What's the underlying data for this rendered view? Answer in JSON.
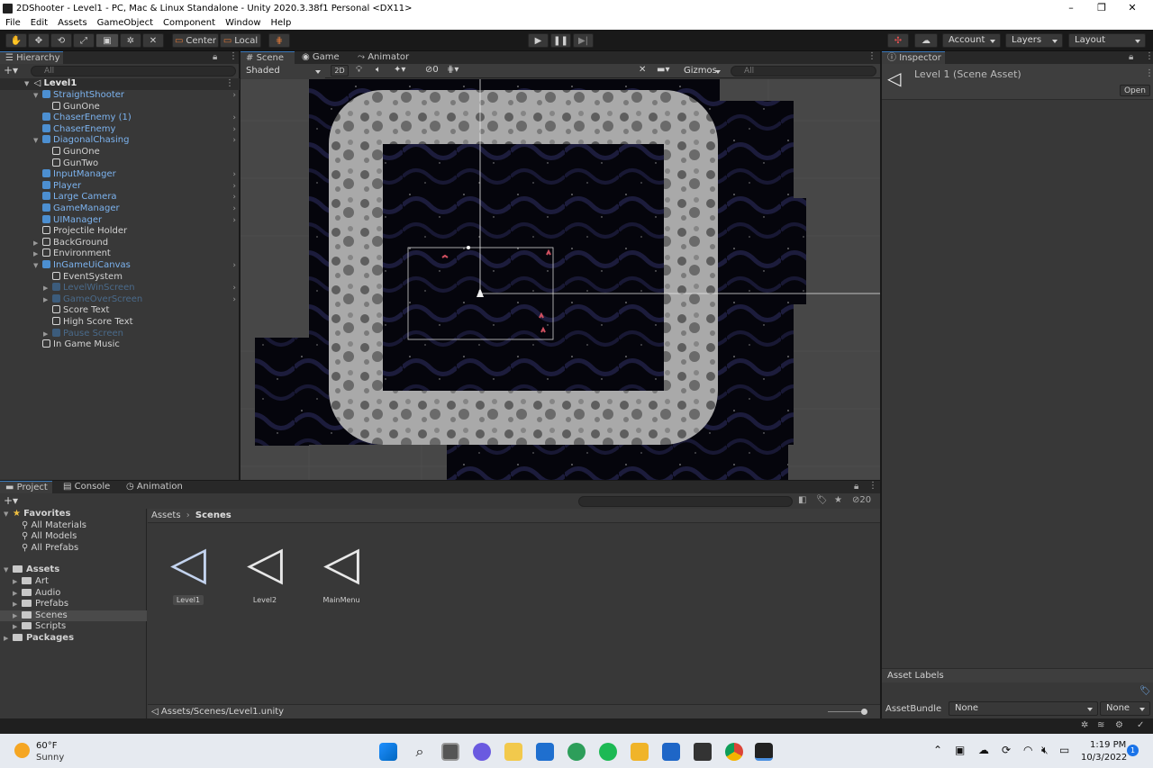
{
  "window": {
    "title": "2DShooter - Level1 - PC, Mac & Linux Standalone - Unity 2020.3.38f1 Personal <DX11>",
    "min": "–",
    "max": "❐",
    "close": "✕"
  },
  "menu": [
    "File",
    "Edit",
    "Assets",
    "GameObject",
    "Component",
    "Window",
    "Help"
  ],
  "toolbar": {
    "center": "Center",
    "local": "Local",
    "account": "Account",
    "layers": "Layers",
    "layout": "Layout"
  },
  "hierarchy": {
    "tab": "Hierarchy",
    "search_placeholder": "All",
    "scene_root": "Level1",
    "items": [
      {
        "label": "StraightShooter",
        "style": "blue",
        "indent": 1,
        "fold": "▼",
        "arrow": true
      },
      {
        "label": "GunOne",
        "style": "white",
        "indent": 2,
        "fold": "",
        "arrow": false
      },
      {
        "label": "ChaserEnemy (1)",
        "style": "blue",
        "indent": 1,
        "fold": "",
        "arrow": true
      },
      {
        "label": "ChaserEnemy",
        "style": "blue",
        "indent": 1,
        "fold": "",
        "arrow": true
      },
      {
        "label": "DiagonalChasing",
        "style": "blue",
        "indent": 1,
        "fold": "▼",
        "arrow": true
      },
      {
        "label": "GunOne",
        "style": "white",
        "indent": 2,
        "fold": "",
        "arrow": false
      },
      {
        "label": "GunTwo",
        "style": "white",
        "indent": 2,
        "fold": "",
        "arrow": false
      },
      {
        "label": "InputManager",
        "style": "blue",
        "indent": 1,
        "fold": "",
        "arrow": true
      },
      {
        "label": "Player",
        "style": "blue",
        "indent": 1,
        "fold": "",
        "arrow": true
      },
      {
        "label": "Large Camera",
        "style": "blue",
        "indent": 1,
        "fold": "",
        "arrow": true
      },
      {
        "label": "GameManager",
        "style": "blue",
        "indent": 1,
        "fold": "",
        "arrow": true
      },
      {
        "label": "UIManager",
        "style": "blue",
        "indent": 1,
        "fold": "",
        "arrow": true
      },
      {
        "label": "Projectile Holder",
        "style": "white",
        "indent": 1,
        "fold": "",
        "arrow": false
      },
      {
        "label": "BackGround",
        "style": "white",
        "indent": 1,
        "fold": "▶",
        "arrow": false
      },
      {
        "label": "Environment",
        "style": "white",
        "indent": 1,
        "fold": "▶",
        "arrow": false
      },
      {
        "label": "InGameUiCanvas",
        "style": "blue",
        "indent": 1,
        "fold": "▼",
        "arrow": true
      },
      {
        "label": "EventSystem",
        "style": "white",
        "indent": 2,
        "fold": "",
        "arrow": false
      },
      {
        "label": "LevelWinScreen",
        "style": "faded",
        "indent": 2,
        "fold": "▶",
        "arrow": true
      },
      {
        "label": "GameOverScreen",
        "style": "faded",
        "indent": 2,
        "fold": "▶",
        "arrow": true
      },
      {
        "label": "Score Text",
        "style": "white",
        "indent": 2,
        "fold": "",
        "arrow": false
      },
      {
        "label": "High Score Text",
        "style": "white",
        "indent": 2,
        "fold": "",
        "arrow": false
      },
      {
        "label": "Pause Screen",
        "style": "faded",
        "indent": 2,
        "fold": "▶",
        "arrow": false
      },
      {
        "label": "In Game Music",
        "style": "white",
        "indent": 1,
        "fold": "",
        "arrow": false
      }
    ]
  },
  "scene": {
    "tabs": [
      "Scene",
      "Game",
      "Animator"
    ],
    "shading": "Shaded",
    "mode_2d": "2D",
    "hidden_count": "0",
    "gizmos": "Gizmos",
    "search_placeholder": "All"
  },
  "inspector": {
    "tab": "Inspector",
    "asset_title": "Level 1 (Scene Asset)",
    "open": "Open",
    "asset_labels": "Asset Labels",
    "asset_bundle": "AssetBundle",
    "bundle_value": "None",
    "variant_value": "None"
  },
  "project": {
    "tabs": [
      "Project",
      "Console",
      "Animation"
    ],
    "hidden_count": "20",
    "breadcrumb": [
      "Assets",
      "Scenes"
    ],
    "tree": [
      {
        "label": "Favorites",
        "kind": "star",
        "indent": 0
      },
      {
        "label": "All Materials",
        "kind": "search",
        "indent": 1
      },
      {
        "label": "All Models",
        "kind": "search",
        "indent": 1
      },
      {
        "label": "All Prefabs",
        "kind": "search",
        "indent": 1
      },
      {
        "label": "Assets",
        "kind": "folder-open",
        "indent": 0
      },
      {
        "label": "Art",
        "kind": "folder",
        "indent": 1
      },
      {
        "label": "Audio",
        "kind": "folder",
        "indent": 1
      },
      {
        "label": "Prefabs",
        "kind": "folder",
        "indent": 1
      },
      {
        "label": "Scenes",
        "kind": "folder",
        "indent": 1
      },
      {
        "label": "Scripts",
        "kind": "folder",
        "indent": 1
      },
      {
        "label": "Packages",
        "kind": "folder",
        "indent": 0
      }
    ],
    "assets": [
      "Level1",
      "Level2",
      "MainMenu"
    ],
    "path": "Assets/Scenes/Level1.unity"
  },
  "taskbar": {
    "temp": "60°F",
    "weather": "Sunny",
    "time": "1:19 PM",
    "date": "10/3/2022",
    "notif": "1"
  }
}
